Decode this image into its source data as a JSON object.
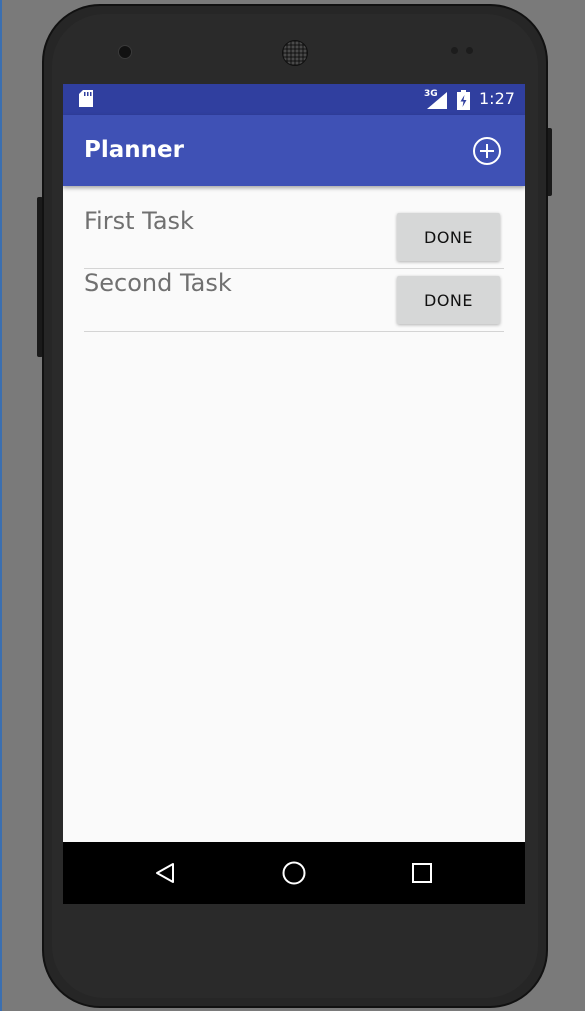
{
  "status_bar": {
    "network": "3G",
    "time": "1:27",
    "icons": [
      "sd-card-icon",
      "signal-icon",
      "battery-charging-icon"
    ]
  },
  "app_bar": {
    "title": "Planner",
    "action_icon": "add-circle-icon"
  },
  "tasks": [
    {
      "name": "First Task",
      "button_label": "DONE"
    },
    {
      "name": "Second Task",
      "button_label": "DONE"
    }
  ],
  "nav_bar": {
    "icons": [
      "back-icon",
      "home-icon",
      "recents-icon"
    ]
  },
  "colors": {
    "status_bar": "#303f9f",
    "app_bar": "#3f51b5",
    "background": "#fafafa",
    "button": "#d6d7d7"
  }
}
